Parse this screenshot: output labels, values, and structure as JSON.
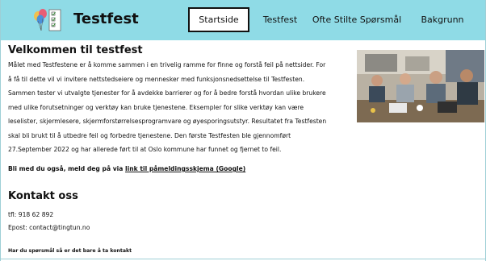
{
  "header": {
    "brand": "Testfest",
    "background_color": "#8fdbe6",
    "logo_icon": "balloons-checklist-icon"
  },
  "nav": {
    "items": [
      {
        "label": "Startside",
        "active": true
      },
      {
        "label": "Testfest",
        "active": false
      },
      {
        "label": "Ofte Stilte Spørsmål",
        "active": false
      },
      {
        "label": "Bakgrunn",
        "active": false
      }
    ]
  },
  "main": {
    "title": "Velkommen til testfest",
    "intro_lines": [
      "Målet med Testfestene er å komme sammen i en trivelig ramme for finne og forstå feil på nettsider. For",
      "å få til dette vil vi invitere nettstedseiere og mennesker med funksjonsnedsettelse til Testfesten.",
      "Sammen tester vi utvalgte tjenester for å avdekke barrierer og for å bedre forstå hvordan ulike brukere",
      "med ulike forutsetninger og verktøy kan bruke tjenestene. Eksempler for slike verktøy kan være",
      "leselister, skjermlesere, skjermforstørrelsesprogramvare og øyesporingsutstyr. Resultatet fra Testfesten",
      "skal bli brukt til å utbedre feil og forbedre tjenestene. Den første Testfesten ble gjennomført",
      "27.September 2022 og har allerede ført til at Oslo kommune har funnet og fjernet to feil."
    ],
    "photo_icon": "group-photo-icon",
    "signup_prefix": "Bli med du også, meld deg på via ",
    "signup_link": "link til påmeldingsskjema (Google)"
  },
  "contact": {
    "title": "Kontakt oss",
    "phone": "tfl: 918 62 892",
    "email": "Epost: contact@tingtun.no",
    "note": "Har du spørsmål så er det bare å ta kontakt"
  }
}
